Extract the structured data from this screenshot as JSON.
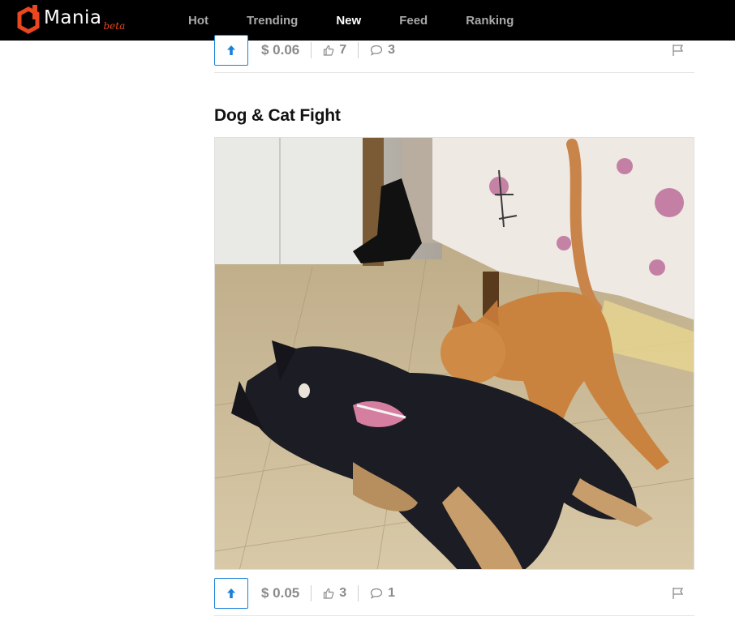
{
  "brand": {
    "name": "Mania",
    "tag": "beta",
    "accent": "#e8471f"
  },
  "nav": {
    "items": [
      {
        "label": "Hot",
        "active": false
      },
      {
        "label": "Trending",
        "active": false
      },
      {
        "label": "New",
        "active": true
      },
      {
        "label": "Feed",
        "active": false
      },
      {
        "label": "Ranking",
        "active": false
      }
    ]
  },
  "posts": [
    {
      "payout": "$ 0.06",
      "likes": "7",
      "comments": "3"
    },
    {
      "title": "Dog & Cat Fight",
      "image": "dog-and-cat-photo",
      "payout": "$ 0.05",
      "likes": "3",
      "comments": "1"
    }
  ],
  "colors": {
    "topbar": "#000000",
    "vote": "#1a81d8",
    "muted": "#8a8a8a"
  }
}
